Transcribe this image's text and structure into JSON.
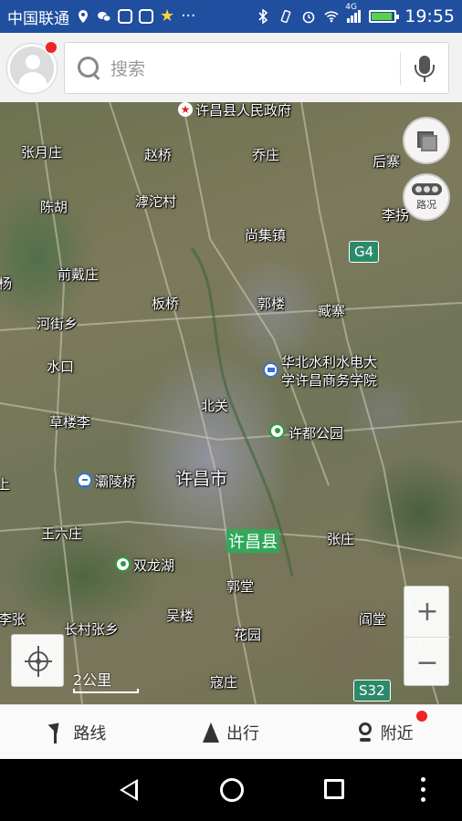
{
  "status_bar": {
    "carrier": "中国联通",
    "more": "···",
    "network": "4G",
    "time": "19:55"
  },
  "search": {
    "placeholder": "搜索"
  },
  "map": {
    "labels": {
      "gov": "许昌县人民政府",
      "zhangyuezhuang": "张月庄",
      "zhaoqiao": "赵桥",
      "qiaozhuang": "乔庄",
      "houzhai": "后寨",
      "chenhu": "陈胡",
      "chuotuocun": "滹沱村",
      "lixu": "李拐",
      "shangjizhen": "尚集镇",
      "yang": "杨",
      "qiandaizhuang": "前戴庄",
      "banqiao": "板桥",
      "guolou": "郭楼",
      "zangzhai": "臧寨",
      "hejiexiang": "河街乡",
      "shuikou": "水口",
      "university": "华北水利水电大\n学许昌商务学院",
      "beiguan": "北关",
      "caolouli": "草楼李",
      "xudu_park": "许都公园",
      "baling_bridge": "灞陵桥",
      "xuchang_city": "许昌市",
      "wangliuzhuang": "王六庄",
      "xuchang_county": "许昌县",
      "zhangzhuang": "张庄",
      "shuanglonghu": "双龙湖",
      "guotang": "郭堂",
      "wulou": "吴楼",
      "lizhang": "李张",
      "changcun": "长村张乡",
      "yantang": "阎堂",
      "huayuan": "花园",
      "kouzhuang": "寇庄",
      "left_edge": "上"
    },
    "shields": {
      "g4": "G4",
      "s32": "S32"
    },
    "traffic_label": "路况",
    "zoom_in": "+",
    "zoom_out": "−",
    "scale": "2公里"
  },
  "bottom_nav": {
    "route": "路线",
    "go": "出行",
    "nearby": "附近"
  }
}
